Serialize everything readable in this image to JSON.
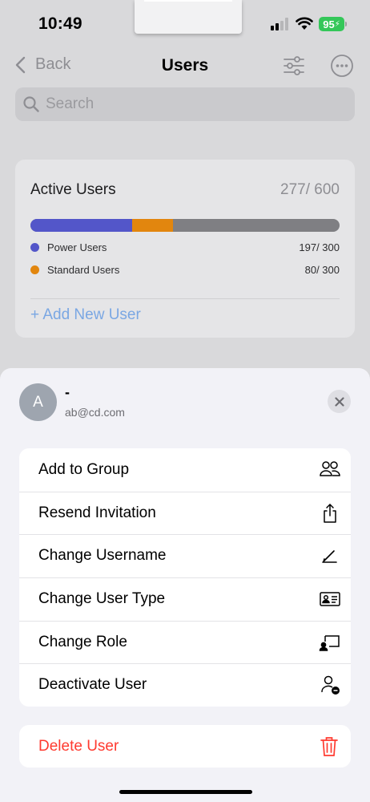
{
  "status": {
    "time": "10:49",
    "battery": "95"
  },
  "nav": {
    "back_label": "Back",
    "title": "Users"
  },
  "search": {
    "placeholder": "Search"
  },
  "summary": {
    "title": "Active Users",
    "count": "277/ 600",
    "segments": [
      {
        "name": "Power Users",
        "value": "197/ 300",
        "fraction": 0.328,
        "color": "#5356c9"
      },
      {
        "name": "Standard Users",
        "value": "80/ 300",
        "fraction": 0.133,
        "color": "#e2860e"
      }
    ],
    "add_user_label": "+ Add New User"
  },
  "sheet": {
    "avatar_letter": "A",
    "user_name": "-",
    "user_email": "ab@cd.com",
    "actions": [
      {
        "label": "Add to Group",
        "icon": "group-icon"
      },
      {
        "label": "Resend Invitation",
        "icon": "share-icon"
      },
      {
        "label": "Change Username",
        "icon": "pencil-icon"
      },
      {
        "label": "Change User Type",
        "icon": "id-card-icon"
      },
      {
        "label": "Change Role",
        "icon": "role-screen-icon"
      },
      {
        "label": "Deactivate User",
        "icon": "person-minus-icon"
      }
    ],
    "delete_label": "Delete User",
    "delete_icon": "trash-icon"
  },
  "colors": {
    "accent_link": "#7aa7e3",
    "danger": "#ff3b30",
    "battery": "#34c759"
  }
}
